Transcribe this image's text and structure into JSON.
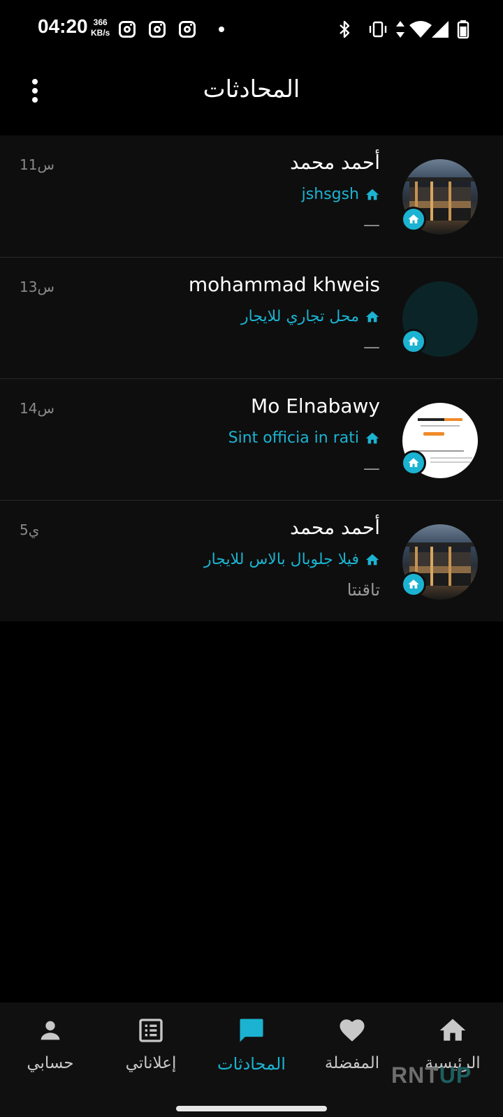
{
  "status_bar": {
    "time": "04:20",
    "speed_value": "366",
    "speed_unit": "KB/s"
  },
  "header": {
    "title": "المحادثات",
    "menu_icon": "more-vertical-icon"
  },
  "conversations": [
    {
      "name": "أحمد محمد",
      "ad_title": "jshsgsh",
      "last_message": "—",
      "time": "11س",
      "avatar": "house-photo"
    },
    {
      "name": "mohammad khweis",
      "ad_title": "محل تجاري للايجار",
      "last_message": "—",
      "time": "13س",
      "avatar": "dark-placeholder"
    },
    {
      "name": "Mo Elnabawy",
      "ad_title": "Sint officia in rati",
      "last_message": "—",
      "time": "14س",
      "avatar": "website-screenshot"
    },
    {
      "name": "أحمد محمد",
      "ad_title": "فيلا جلوبال بالاس للايجار",
      "last_message": "تاقنتا",
      "time": "5ي",
      "avatar": "house-photo"
    }
  ],
  "bottom_nav": {
    "items": [
      {
        "label": "حسابي",
        "icon": "person-icon"
      },
      {
        "label": "إعلاناتي",
        "icon": "list-alt-icon"
      },
      {
        "label": "المحادثات",
        "icon": "chat-icon"
      },
      {
        "label": "المفضلة",
        "icon": "heart-icon"
      },
      {
        "label": "الرئيسية",
        "icon": "home-icon"
      }
    ],
    "active": "المحادثات"
  },
  "watermark": {
    "part1": "RNT",
    "part2": "UP"
  },
  "colors": {
    "accent": "#1bb3d1",
    "background": "#000000",
    "card": "#0e0e0e"
  }
}
